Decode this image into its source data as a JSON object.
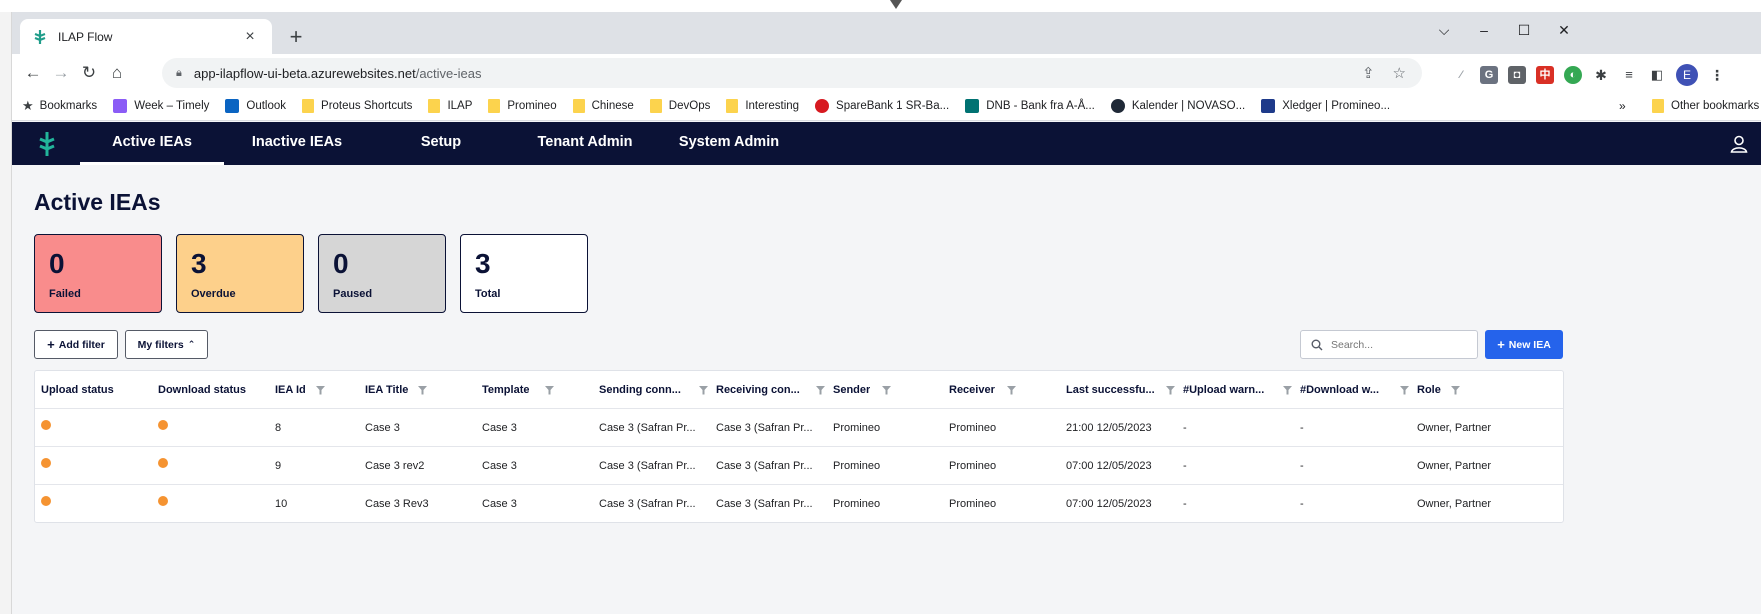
{
  "browser": {
    "tab": {
      "title": "ILAP Flow",
      "close": "×"
    },
    "new_tab": "+",
    "window_controls": {
      "dropdown": "⌵",
      "minimize": "–",
      "maximize": "☐",
      "close": "✕"
    },
    "url": {
      "host": "app-ilapflow-ui-beta.azurewebsites.net",
      "path": "/active-ieas"
    },
    "profile_initial": "E",
    "bookmarks": [
      {
        "label": "Bookmarks",
        "icon": "star-icon"
      },
      {
        "label": "Week – Timely",
        "icon": "timely-icon"
      },
      {
        "label": "Outlook",
        "icon": "outlook-icon"
      },
      {
        "label": "Proteus Shortcuts",
        "icon": "folder-icon"
      },
      {
        "label": "ILAP",
        "icon": "folder-icon"
      },
      {
        "label": "Promineo",
        "icon": "folder-icon"
      },
      {
        "label": "Chinese",
        "icon": "folder-icon"
      },
      {
        "label": "DevOps",
        "icon": "folder-icon"
      },
      {
        "label": "Interesting",
        "icon": "folder-icon"
      },
      {
        "label": "SpareBank 1 SR-Ba...",
        "icon": "sparebank-icon"
      },
      {
        "label": "DNB - Bank fra A-Å...",
        "icon": "dnb-icon"
      },
      {
        "label": "Kalender | NOVASO...",
        "icon": "novaso-icon"
      },
      {
        "label": "Xledger | Promineo...",
        "icon": "xledger-icon"
      }
    ],
    "bookmarks_more": "»",
    "other_bookmarks": "Other bookmarks"
  },
  "nav": {
    "items": [
      "Active IEAs",
      "Inactive IEAs",
      "Setup",
      "Tenant Admin",
      "System Admin"
    ],
    "active_index": 0
  },
  "page": {
    "title": "Active IEAs",
    "stats": [
      {
        "value": "0",
        "label": "Failed",
        "color": "#f98c8c"
      },
      {
        "value": "3",
        "label": "Overdue",
        "color": "#fdd08b"
      },
      {
        "value": "0",
        "label": "Paused",
        "color": "#d6d6d6"
      },
      {
        "value": "3",
        "label": "Total",
        "color": "#ffffff"
      }
    ],
    "add_filter": "Add filter",
    "my_filters": "My filters",
    "search_placeholder": "Search...",
    "new_iea": "New IEA"
  },
  "table": {
    "columns": [
      "Upload status",
      "Download status",
      "IEA Id",
      "IEA Title",
      "Template",
      "Sending conn...",
      "Receiving con...",
      "Sender",
      "Receiver",
      "Last successfu...",
      "#Upload warn...",
      "#Download w...",
      "Role"
    ],
    "status_color": "#f59331",
    "rows": [
      {
        "upload_status": "orange",
        "download_status": "orange",
        "iea_id": "8",
        "title": "Case 3",
        "template": "Case 3",
        "sending": "Case 3 (Safran Pr...",
        "receiving": "Case 3 (Safran Pr...",
        "sender": "Promineo",
        "receiver": "Promineo",
        "last_success": "21:00 12/05/2023",
        "upload_warn": "-",
        "download_warn": "-",
        "role": "Owner, Partner"
      },
      {
        "upload_status": "orange",
        "download_status": "orange",
        "iea_id": "9",
        "title": "Case 3 rev2",
        "template": "Case 3",
        "sending": "Case 3 (Safran Pr...",
        "receiving": "Case 3 (Safran Pr...",
        "sender": "Promineo",
        "receiver": "Promineo",
        "last_success": "07:00 12/05/2023",
        "upload_warn": "-",
        "download_warn": "-",
        "role": "Owner, Partner"
      },
      {
        "upload_status": "orange",
        "download_status": "orange",
        "iea_id": "10",
        "title": "Case 3 Rev3",
        "template": "Case 3",
        "sending": "Case 3 (Safran Pr...",
        "receiving": "Case 3 (Safran Pr...",
        "sender": "Promineo",
        "receiver": "Promineo",
        "last_success": "07:00 12/05/2023",
        "upload_warn": "-",
        "download_warn": "-",
        "role": "Owner, Partner"
      }
    ]
  }
}
